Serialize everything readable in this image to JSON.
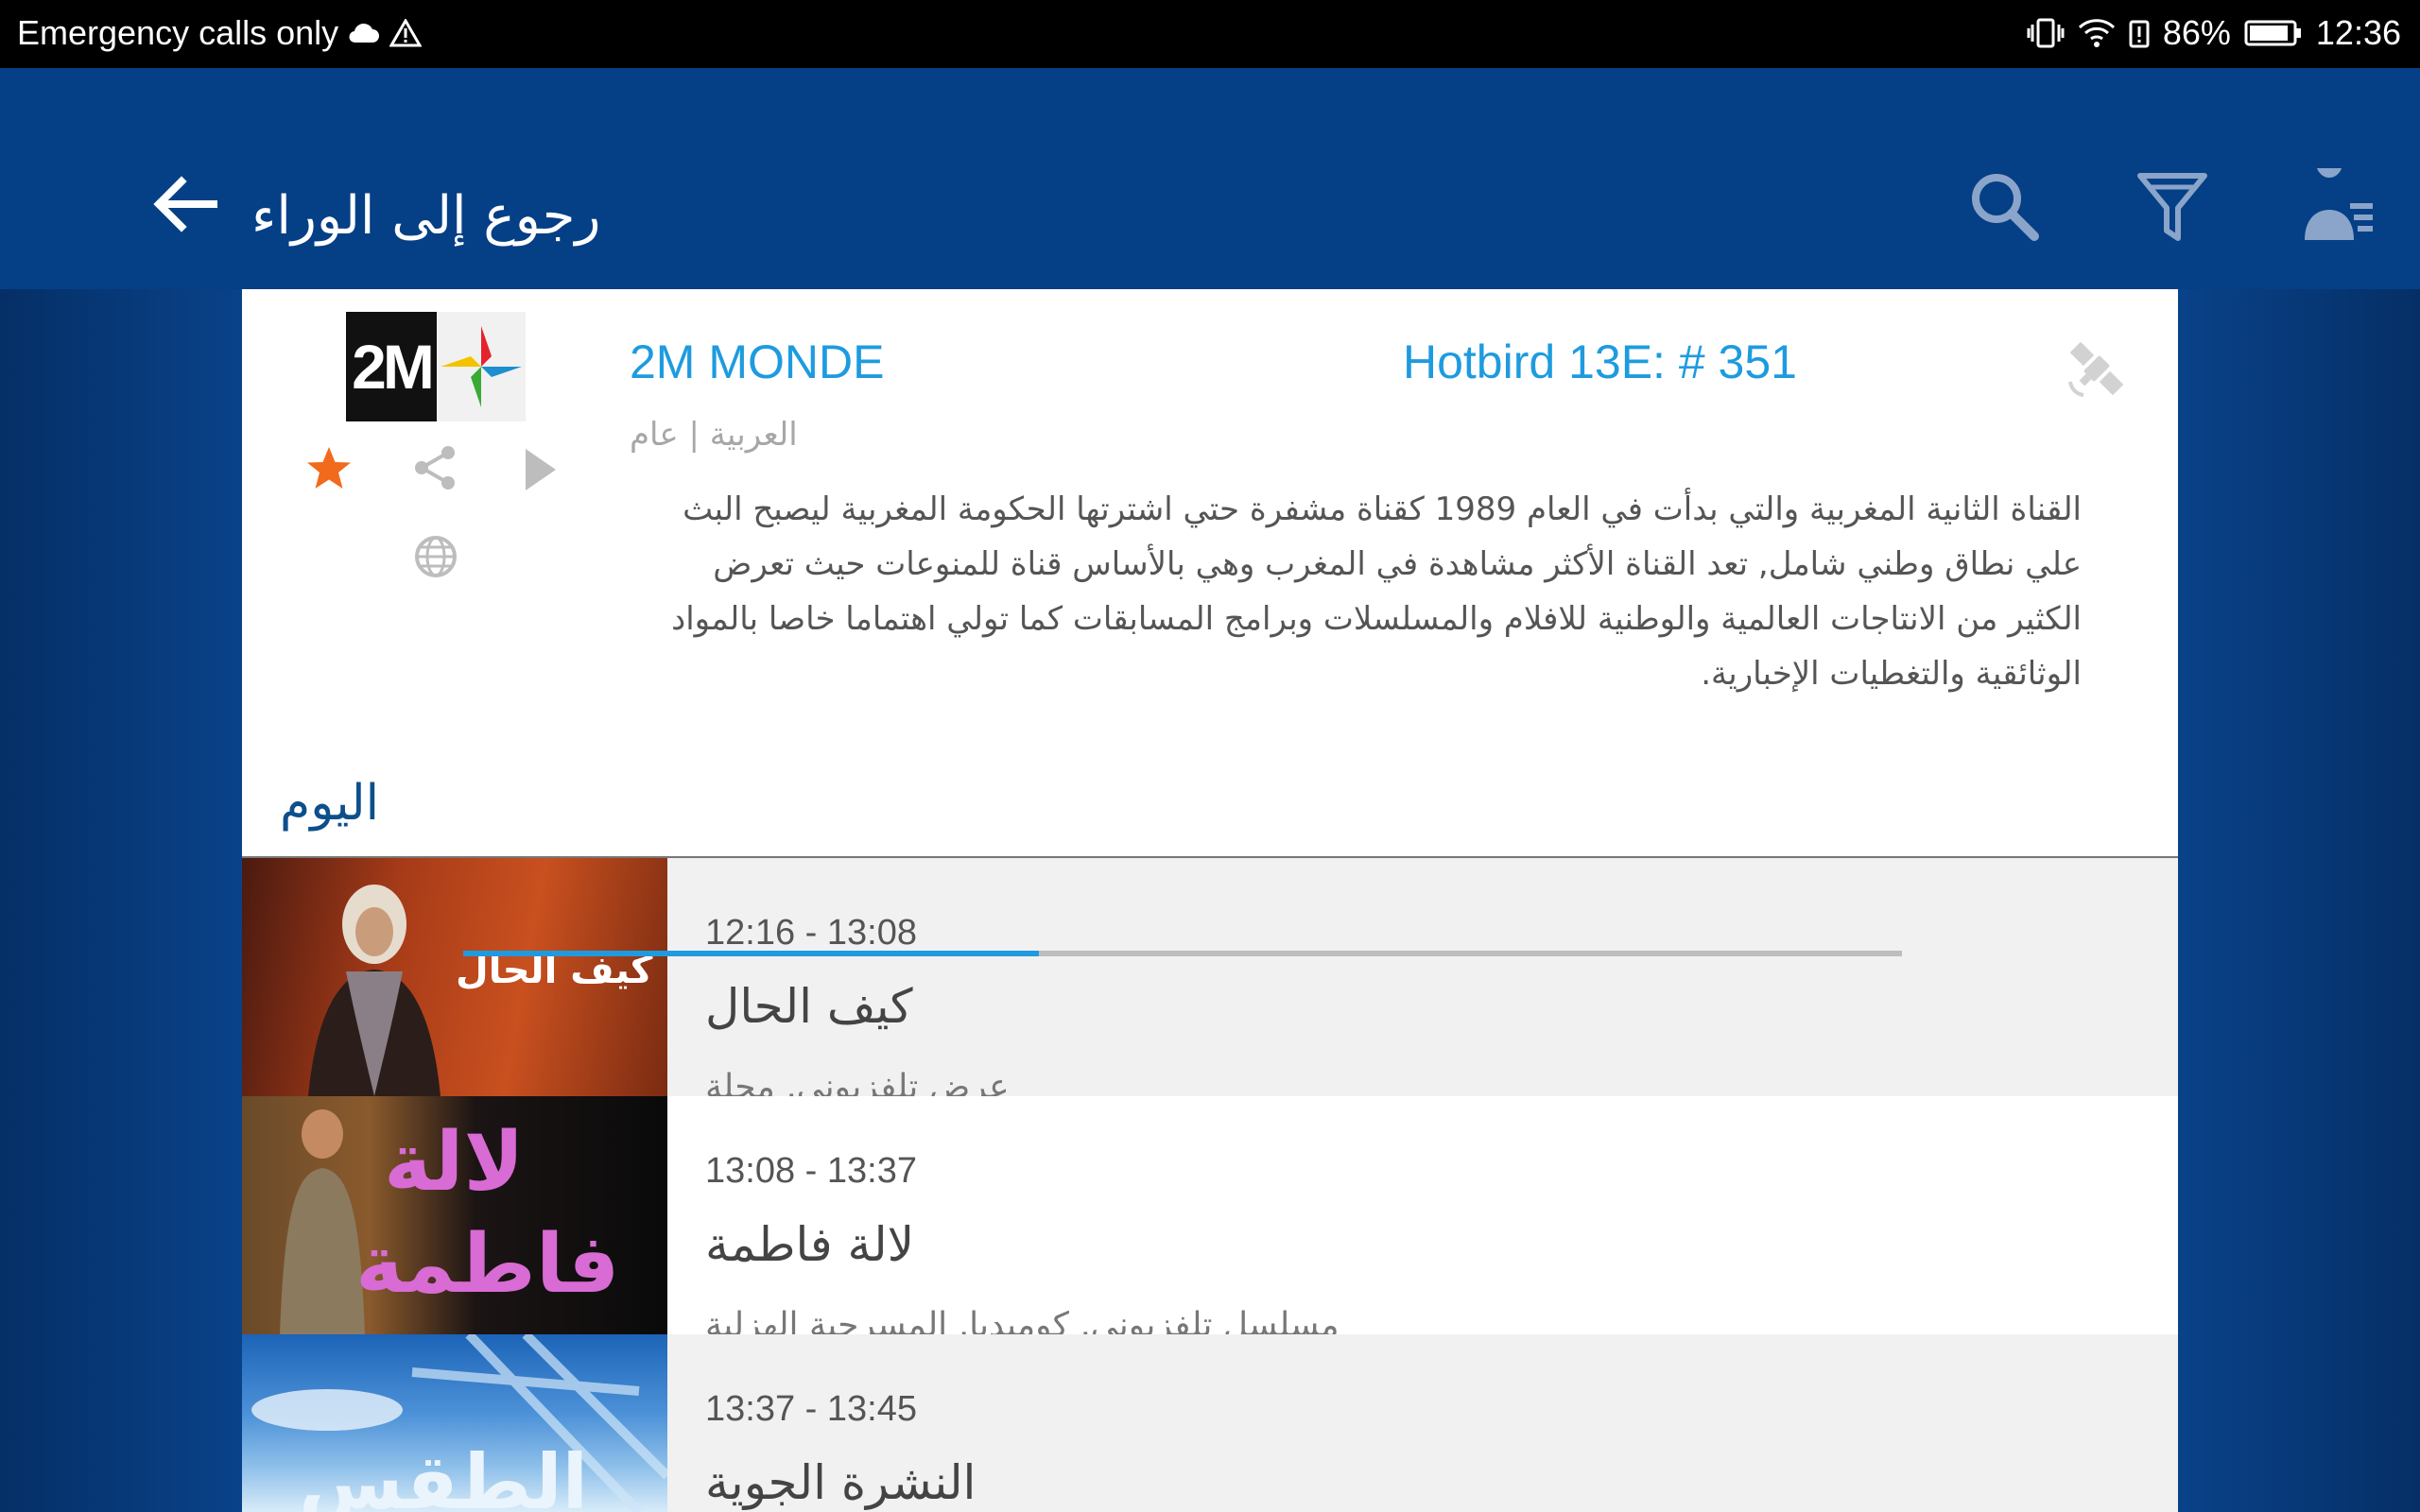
{
  "status_bar": {
    "left_text": "Emergency calls only",
    "battery": "86%",
    "time": "12:36"
  },
  "app_bar": {
    "back_label": "رجوع إلى الوراء"
  },
  "channel": {
    "logo_text": "2M",
    "name": "2M MONDE",
    "satellite": "Hotbird 13E: # 351",
    "meta": "العربية | عام",
    "description": "القناة الثانية المغربية والتي بدأت في العام 1989 كقناة مشفرة حتي اشترتها الحكومة المغربية ليصبح البث علي نطاق وطني شامل, تعد القناة الأكثر مشاهدة في المغرب وهي بالأساس قناة للمنوعات حيث تعرض الكثير من الانتاجات العالمية والوطنية للافلام والمسلسلات وبرامج المسابقات كما تولي اهتماما خاصا بالمواد الوثائقية والتغطيات الإخبارية."
  },
  "schedule": {
    "day_label": "اليوم",
    "programs": [
      {
        "time": "12:16 - 13:08",
        "title": "كيف الحال",
        "genre": "عرض تلفزيوني, مجلة",
        "thumb_text": "كيف الحال",
        "progress": 0.4
      },
      {
        "time": "13:08 - 13:37",
        "title": "لالة فاطمة",
        "genre": "مسلسل تلفزيوني, كوميديا, المسرحية الهزلية",
        "thumb_text_1": "لالة",
        "thumb_text_2": "فاطمة"
      },
      {
        "time": "13:37 - 13:45",
        "title": "النشرة الجوية",
        "thumb_text": "الطقس"
      }
    ]
  },
  "colors": {
    "app_blue": "#053f86",
    "accent": "#1e9bdf",
    "favorite": "#f26a1b"
  }
}
